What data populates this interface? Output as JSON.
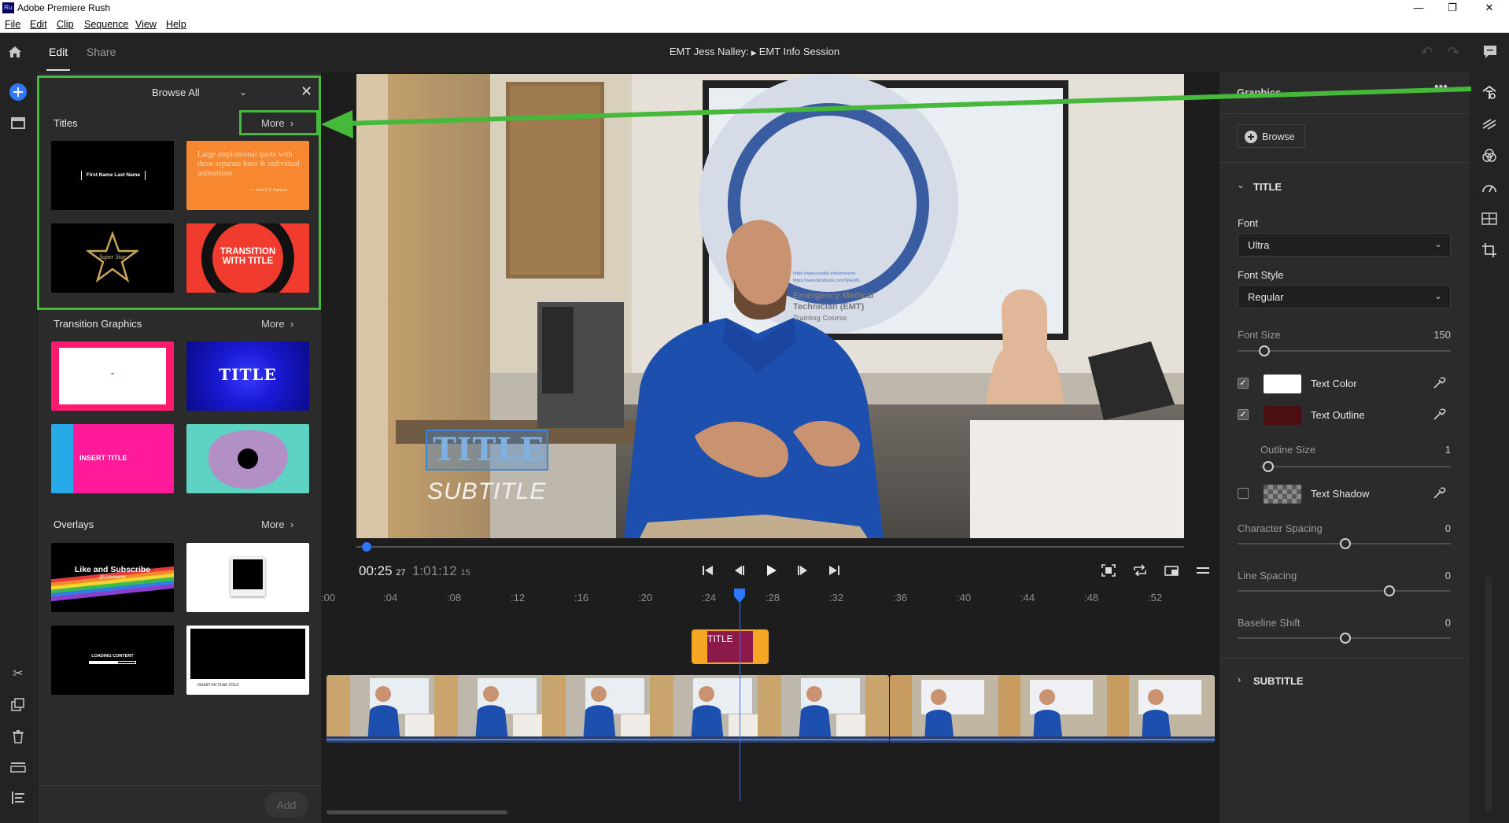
{
  "window": {
    "app_title": "Adobe Premiere Rush",
    "app_icon": "Ru",
    "minimize": "—",
    "maximize": "❐",
    "close": "✕"
  },
  "menu": [
    "File",
    "Edit",
    "Clip",
    "Sequence",
    "View",
    "Help"
  ],
  "header": {
    "tabs": [
      "Edit",
      "Share"
    ],
    "project_name": "EMT  Jess  Nalley:",
    "sequence_name": "EMT Info Session"
  },
  "browse_panel": {
    "filter_label": "Browse All",
    "sections": [
      {
        "label": "Titles",
        "more": "More"
      },
      {
        "label": "Transition Graphics",
        "more": "More"
      },
      {
        "label": "Overlays",
        "more": "More"
      }
    ],
    "thumbs": {
      "t1": "First Name Last Name",
      "t2": "Large inspirational quote with three separate lines & individual animations",
      "t2_sig": "— Soul K.Y. Famous",
      "t3": "Super Star",
      "t4": "TRANSITION WITH TITLE",
      "g1": "-",
      "g2": "TITLE",
      "g3": "INSERT TITLE",
      "o1": "Like and Subscribe",
      "o1_sub": "@Username",
      "o3": "LOADING CONTENT",
      "o4": "INSERT PICTURE TITLE"
    },
    "add_label": "Add"
  },
  "preview": {
    "overlay_title": "TITLE",
    "overlay_subtitle": "SUBTITLE",
    "screen_lines": [
      "Emergency Medical",
      "Technician (EMT)",
      "Training Course"
    ],
    "screen_links": [
      "https://www.southk.edu/ems/emt",
      "https://www.facebook.com/SKEMS"
    ],
    "progress": 0.008
  },
  "transport": {
    "current_time": "00:25",
    "current_frames": "27",
    "duration": "1:01:12",
    "duration_frames": "15"
  },
  "timeline": {
    "ruler": [
      ":00",
      ":04",
      ":08",
      ":12",
      ":16",
      ":20",
      ":24",
      ":28",
      ":32",
      ":36",
      ":40",
      ":44",
      ":48",
      ":52"
    ],
    "title_clip_label": "TITLE"
  },
  "graphics_panel": {
    "header": "Graphics",
    "browse_btn": "Browse",
    "title_section": "TITLE",
    "font_label": "Font",
    "font_value": "Ultra",
    "font_style_label": "Font Style",
    "font_style_value": "Regular",
    "font_size_label": "Font Size",
    "font_size_value": "150",
    "font_size_level": 0.1,
    "text_color_label": "Text Color",
    "text_color": "#ffffff",
    "text_color_checked": true,
    "text_outline_label": "Text Outline",
    "text_outline_color": "#4a1010",
    "text_outline_checked": true,
    "outline_size_label": "Outline Size",
    "outline_size_value": "1",
    "text_shadow_label": "Text Shadow",
    "text_shadow_checked": false,
    "char_spacing_label": "Character Spacing",
    "char_spacing_value": "0",
    "line_spacing_label": "Line Spacing",
    "line_spacing_value": "0",
    "baseline_label": "Baseline Shift",
    "baseline_value": "0",
    "subtitle_section": "SUBTITLE"
  },
  "colors": {
    "accent_blue": "#2e78ff",
    "highlight_green": "#46b83a",
    "clip_orange": "#f5a623",
    "clip_magenta": "#8b1a4a"
  }
}
